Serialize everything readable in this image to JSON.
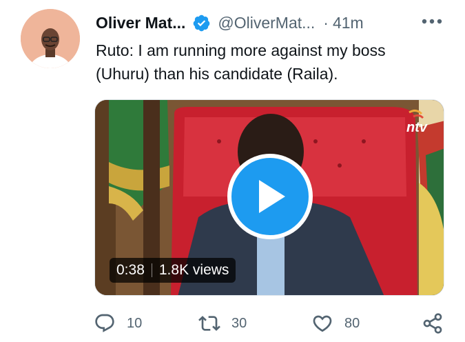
{
  "author": {
    "name": "Oliver Mat...",
    "handle": "@OliverMat...",
    "separator": "·",
    "time": "41m",
    "verified": true,
    "avatar_icon": "user-avatar"
  },
  "tweet": {
    "text": "Ruto: I am running more against my boss\n(Uhuru) than his candidate (Raila)."
  },
  "media": {
    "type": "video",
    "duration": "0:38",
    "views": "1.8K views",
    "channel_logo": "ntv"
  },
  "actions": {
    "reply": {
      "icon": "reply-icon",
      "count": "10"
    },
    "retweet": {
      "icon": "retweet-icon",
      "count": "30"
    },
    "like": {
      "icon": "heart-icon",
      "count": "80"
    },
    "share": {
      "icon": "share-icon"
    }
  },
  "colors": {
    "accent": "#1d9bf0",
    "text": "#0f1419",
    "muted": "#536471"
  }
}
